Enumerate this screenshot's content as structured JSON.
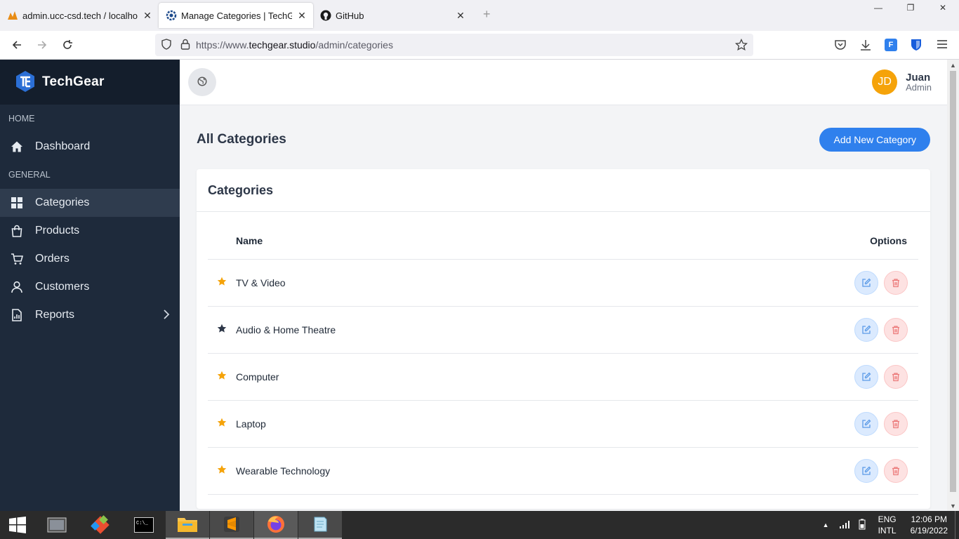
{
  "browser": {
    "tabs": [
      {
        "title": "admin.ucc-csd.tech / localhost",
        "active": false
      },
      {
        "title": "Manage Categories | TechGear A",
        "active": true
      },
      {
        "title": "GitHub",
        "active": false
      }
    ],
    "url_prefix": "https://www.",
    "url_domain": "techgear.studio",
    "url_path": "/admin/categories"
  },
  "sidebar": {
    "brand": "TechGear",
    "sections": {
      "home": "HOME",
      "general": "GENERAL"
    },
    "items": [
      {
        "label": "Dashboard",
        "icon": "home-icon"
      },
      {
        "label": "Categories",
        "icon": "grid-icon",
        "active": true
      },
      {
        "label": "Products",
        "icon": "bag-icon"
      },
      {
        "label": "Orders",
        "icon": "cart-icon"
      },
      {
        "label": "Customers",
        "icon": "user-icon"
      },
      {
        "label": "Reports",
        "icon": "report-icon"
      }
    ]
  },
  "header": {
    "user_initials": "JD",
    "user_name": "Juan",
    "user_role": "Admin"
  },
  "page": {
    "title": "All Categories",
    "add_button": "Add New Category"
  },
  "card": {
    "title": "Categories",
    "col_name": "Name",
    "col_options": "Options",
    "rows": [
      {
        "name": "TV & Video",
        "star_color": "#f5a30a"
      },
      {
        "name": "Audio & Home Theatre",
        "star_color": "#2d3748"
      },
      {
        "name": "Computer",
        "star_color": "#f5a30a"
      },
      {
        "name": "Laptop",
        "star_color": "#f5a30a"
      },
      {
        "name": "Wearable Technology",
        "star_color": "#f5a30a"
      }
    ]
  },
  "taskbar": {
    "lang1": "ENG",
    "lang2": "INTL",
    "time": "12:06 PM",
    "date": "6/19/2022"
  },
  "colors": {
    "accent": "#2f80ed",
    "sidebar": "#1e2a3b",
    "star": "#f5a30a"
  }
}
